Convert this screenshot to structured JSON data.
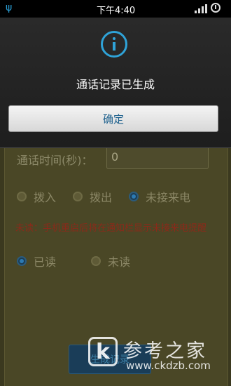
{
  "status_bar": {
    "time": "下午4:40"
  },
  "dialog": {
    "title": "通话记录已生成",
    "confirm_label": "确定"
  },
  "form": {
    "duration_label": "通话时间(秒)：",
    "duration_value": "0",
    "call_types": [
      "拨入",
      "拨出",
      "未接来电"
    ],
    "call_type_selected": "未接来电",
    "notice": "未读：手机重启后将在通知栏显示未接来电提醒",
    "read_options": [
      "已读",
      "未读"
    ],
    "read_selected": "已读",
    "bottom_button_label": "生成记录"
  },
  "watermark": {
    "brand_cn": "参考之家",
    "url": "www.ckdzb.com",
    "logo_letter": "k"
  },
  "colors": {
    "accent": "#2fa3d8",
    "notice": "#8a2a1a"
  }
}
